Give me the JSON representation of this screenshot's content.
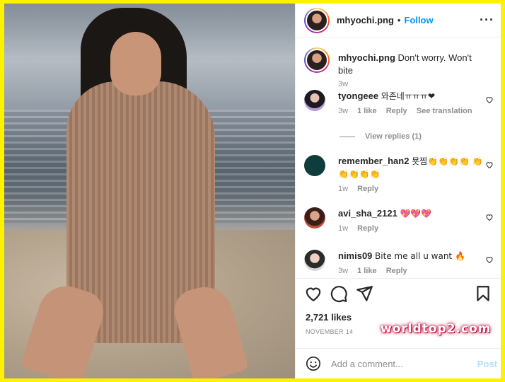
{
  "header": {
    "username": "mhyochi.png",
    "separator": "•",
    "follow_label": "Follow",
    "more_icon": "more-options-icon"
  },
  "caption": {
    "username": "mhyochi.png",
    "text": "Don't worry. Won't bite",
    "time": "3w"
  },
  "comments": [
    {
      "username": "tyongeee",
      "text": "와존네ㅠㅠㅠ❤",
      "time": "3w",
      "likes": "1 like",
      "reply": "Reply",
      "translate": "See translation",
      "view_replies": "View replies (1)"
    },
    {
      "username": "remember_han2",
      "text": "묫찜👏👏👏👏 👏👏👏👏👏",
      "time": "1w",
      "reply": "Reply"
    },
    {
      "username": "avi_sha_2121",
      "text": "💖💖💖",
      "time": "1w",
      "reply": "Reply"
    },
    {
      "username": "nimis09",
      "text": "Bite me all u want 🔥",
      "time": "3w",
      "likes": "1 like",
      "reply": "Reply"
    }
  ],
  "actions": {
    "like_icon": "heart-icon",
    "comment_icon": "comment-icon",
    "share_icon": "share-icon",
    "save_icon": "bookmark-icon",
    "likes_count": "2,721 likes",
    "date": "NOVEMBER 14"
  },
  "add_comment": {
    "emoji_icon": "emoji-icon",
    "placeholder": "Add a comment...",
    "post_label": "Post"
  },
  "watermark": "worldtop2.com",
  "colors": {
    "follow": "#0095f6",
    "heart": "#e8174d",
    "border": "#fff200",
    "post_disabled": "#b2dffc"
  }
}
